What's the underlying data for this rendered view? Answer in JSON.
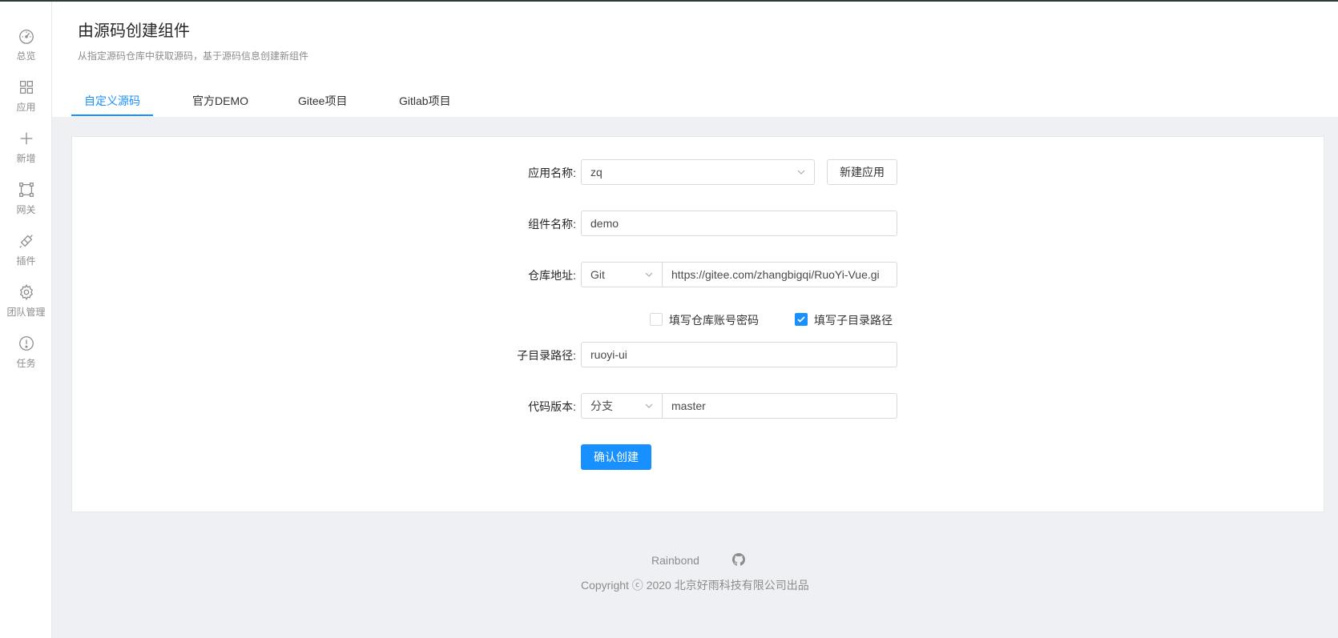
{
  "sidebar": {
    "items": [
      {
        "label": "总览",
        "icon": "dashboard-icon"
      },
      {
        "label": "应用",
        "icon": "apps-grid-icon"
      },
      {
        "label": "新增",
        "icon": "plus-icon"
      },
      {
        "label": "网关",
        "icon": "gateway-icon"
      },
      {
        "label": "插件",
        "icon": "plugin-icon"
      },
      {
        "label": "团队管理",
        "icon": "gear-icon"
      },
      {
        "label": "任务",
        "icon": "alert-circle-icon"
      }
    ]
  },
  "header": {
    "title": "由源码创建组件",
    "description": "从指定源码仓库中获取源码，基于源码信息创建新组件",
    "tabs": [
      {
        "label": "自定义源码",
        "active": true
      },
      {
        "label": "官方DEMO",
        "active": false
      },
      {
        "label": "Gitee项目",
        "active": false
      },
      {
        "label": "Gitlab项目",
        "active": false
      }
    ]
  },
  "form": {
    "app_name_label": "应用名称:",
    "app_name_value": "zq",
    "new_app_button": "新建应用",
    "component_name_label": "组件名称:",
    "component_name_value": "demo",
    "repo_label": "仓库地址:",
    "repo_type_value": "Git",
    "repo_url_value": "https://gitee.com/zhangbigqi/RuoYi-Vue.gi",
    "checkbox_credentials_label": "填写仓库账号密码",
    "checkbox_credentials_checked": false,
    "checkbox_subdir_label": "填写子目录路径",
    "checkbox_subdir_checked": true,
    "subdir_label": "子目录路径:",
    "subdir_value": "ruoyi-ui",
    "version_label": "代码版本:",
    "version_type_value": "分支",
    "version_value": "master",
    "submit_button": "确认创建"
  },
  "footer": {
    "link": "Rainbond",
    "copyright": "Copyright ⓒ 2020 北京好雨科技有限公司出品"
  },
  "colors": {
    "primary": "#1890ff",
    "background": "#eff0f4"
  }
}
